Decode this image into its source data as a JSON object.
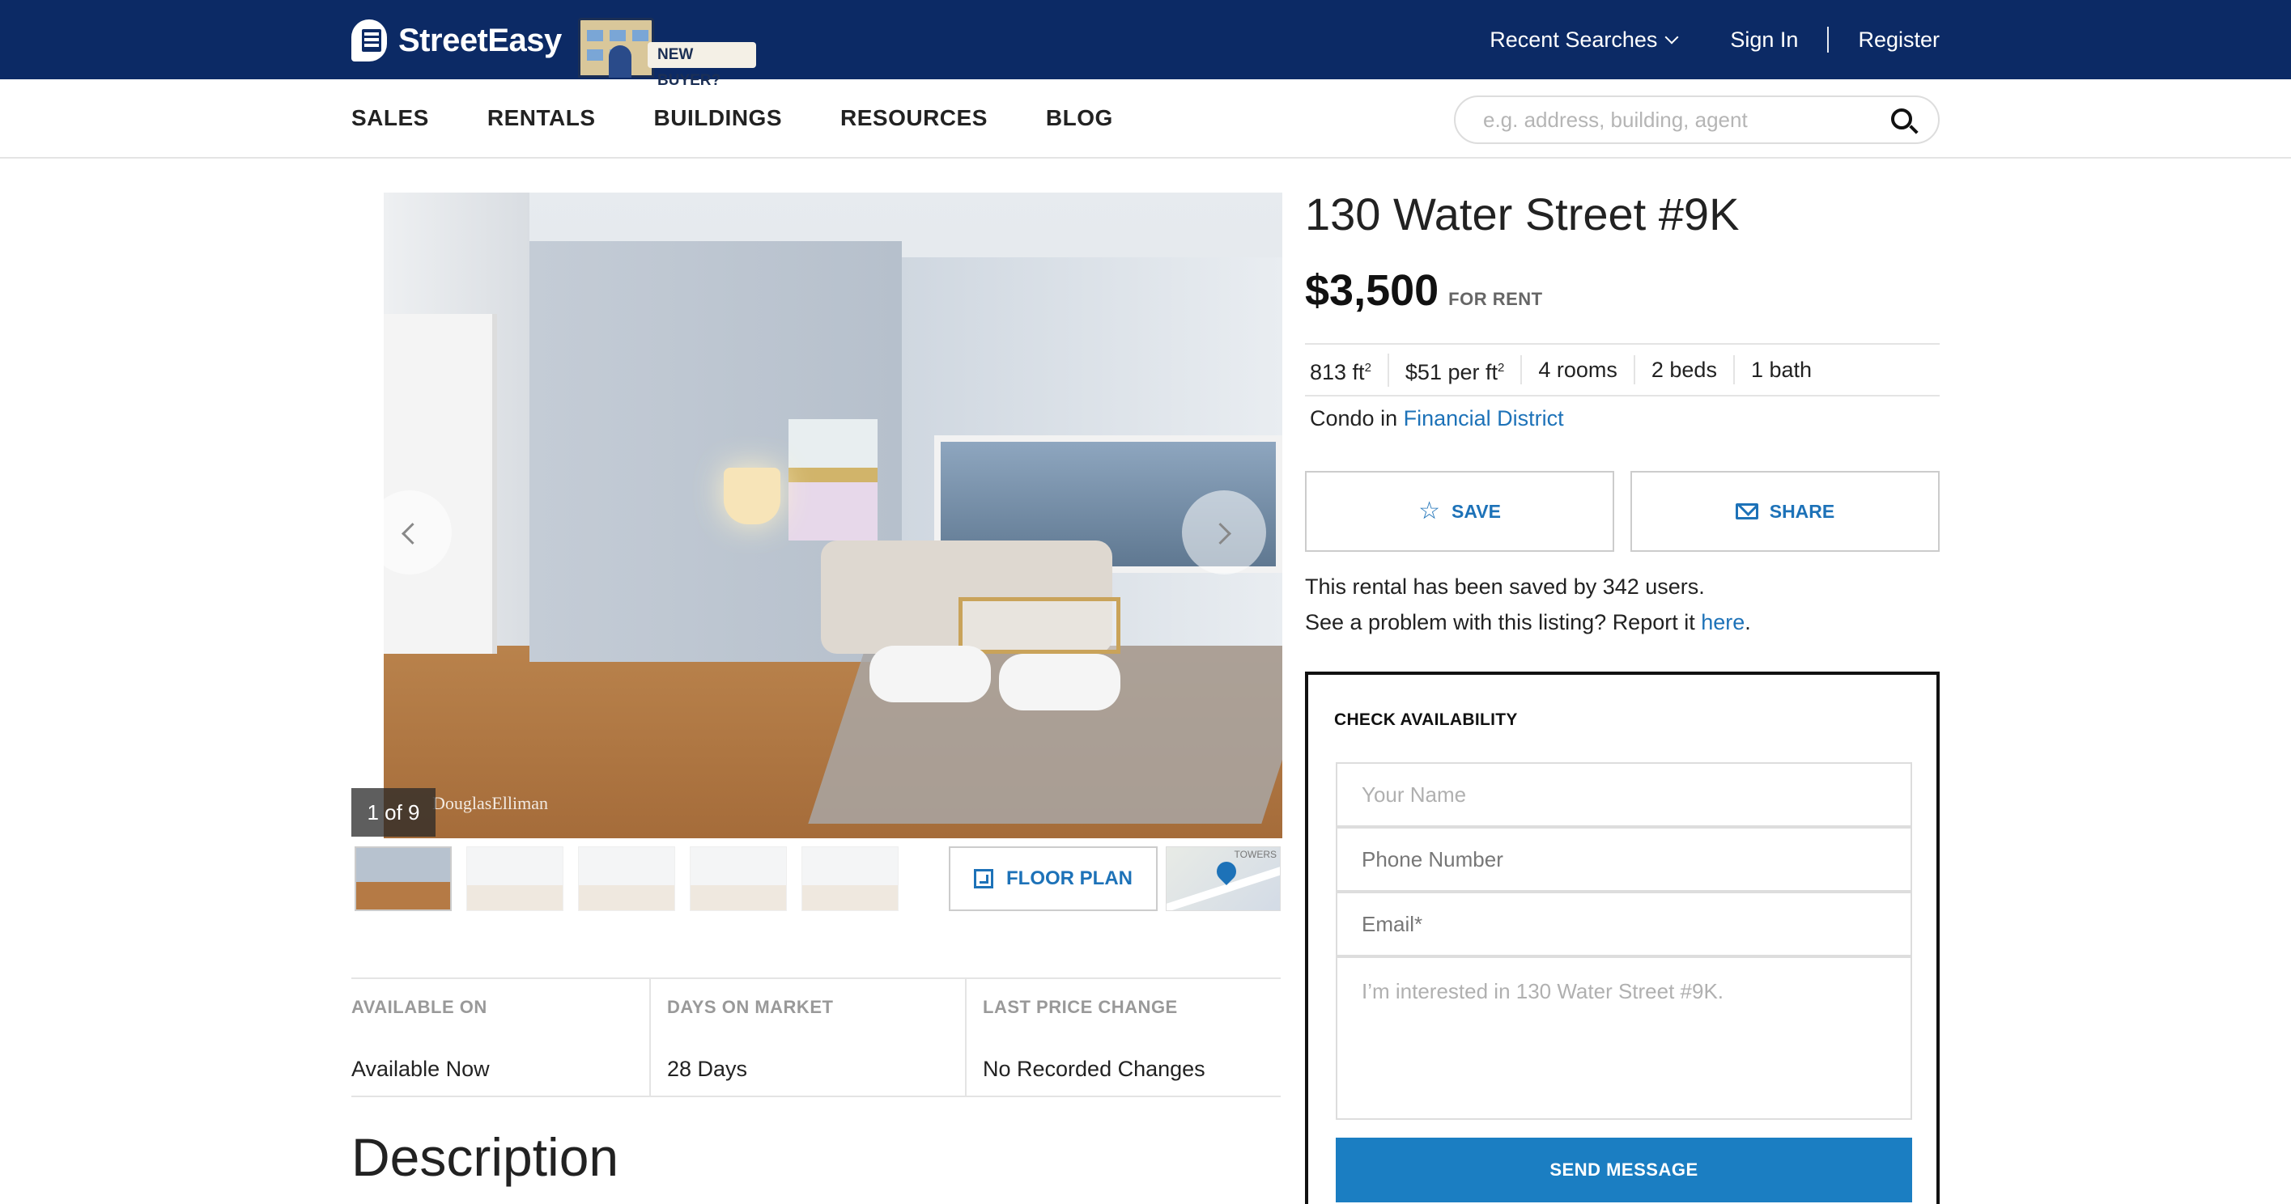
{
  "brand": {
    "name": "StreetEasy",
    "promo_tag": "NEW BUYER?"
  },
  "topnav": {
    "recent_searches": "Recent Searches",
    "sign_in": "Sign In",
    "register": "Register"
  },
  "subnav": {
    "items": [
      "SALES",
      "RENTALS",
      "BUILDINGS",
      "RESOURCES",
      "BLOG"
    ]
  },
  "search": {
    "placeholder": "e.g. address, building, agent",
    "value": ""
  },
  "gallery": {
    "counter": "1 of 9",
    "watermark": "DouglasElliman",
    "floor_plan_label": "FLOOR PLAN",
    "map_label": "TOWERS"
  },
  "listing": {
    "address": "130 Water Street #9K",
    "price": "$3,500",
    "price_type": "FOR RENT",
    "area": "813 ft",
    "price_per_ft": "$51 per ft",
    "rooms": "4 rooms",
    "beds": "2 beds",
    "baths": "1 bath",
    "type_prefix": "Condo in ",
    "neighborhood": "Financial District",
    "save_label": "SAVE",
    "share_label": "SHARE",
    "saved_note": "This rental has been saved by 342 users.",
    "problem_prefix": "See a problem with this listing? Report it ",
    "problem_link": "here",
    "problem_suffix": "."
  },
  "stats": [
    {
      "label": "AVAILABLE ON",
      "value": "Available Now"
    },
    {
      "label": "DAYS ON MARKET",
      "value": "28 Days"
    },
    {
      "label": "LAST PRICE CHANGE",
      "value": "No Recorded Changes"
    }
  ],
  "description_title": "Description",
  "availability": {
    "title": "CHECK AVAILABILITY",
    "name_placeholder": "Your Name",
    "phone_placeholder": "Phone Number",
    "email_placeholder": "Email*",
    "message_placeholder": "I’m interested in 130 Water Street #9K.",
    "send_label": "SEND MESSAGE"
  },
  "colors": {
    "header_bg": "#0c2a65",
    "accent": "#1d72b8",
    "send_button": "#1b7ec2"
  }
}
